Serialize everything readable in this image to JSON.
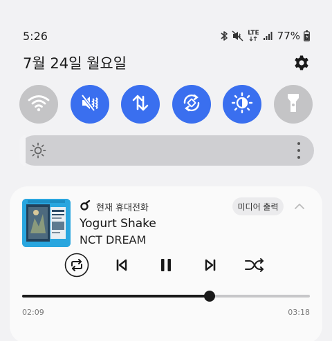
{
  "status_bar": {
    "time": "5:26",
    "network": "LTE",
    "battery": "77%",
    "icons": [
      "bluetooth-icon",
      "mute-icon",
      "lte-icon",
      "signal-icon",
      "battery-icon"
    ]
  },
  "date": "7월 24일 월요일",
  "quick_settings": [
    {
      "name": "wifi",
      "state": "off"
    },
    {
      "name": "mute",
      "state": "on"
    },
    {
      "name": "mobile-data",
      "state": "on"
    },
    {
      "name": "auto-rotate",
      "state": "on"
    },
    {
      "name": "eye-comfort",
      "state": "on"
    },
    {
      "name": "flashlight",
      "state": "off"
    }
  ],
  "brightness_level": 0.02,
  "media": {
    "source": "현재 휴대전화",
    "output_button": "미디어 출력",
    "title": "Yogurt Shake",
    "artist": "NCT DREAM",
    "elapsed": "02:09",
    "duration": "03:18",
    "progress": 0.652
  },
  "colors": {
    "accent": "#3a6fef",
    "tile_off": "#c4c4c6",
    "background": "#f2f2f4",
    "card": "#fafafa"
  }
}
